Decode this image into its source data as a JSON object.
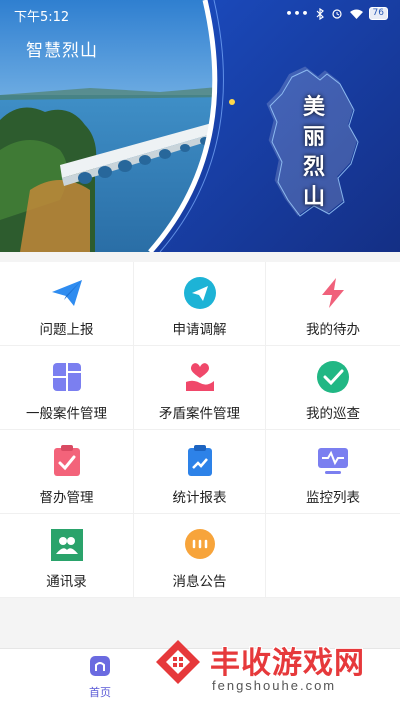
{
  "status_bar": {
    "time": "下午5:12",
    "battery": "76"
  },
  "header": {
    "title": "智慧烈山",
    "banner_slogan": "美丽烈山"
  },
  "menu": [
    {
      "label": "问题上报",
      "icon": "paper-plane-icon"
    },
    {
      "label": "申请调解",
      "icon": "send-circle-icon"
    },
    {
      "label": "我的待办",
      "icon": "lightning-icon"
    },
    {
      "label": "一般案件管理",
      "icon": "grid-panel-icon"
    },
    {
      "label": "矛盾案件管理",
      "icon": "heart-hand-icon"
    },
    {
      "label": "我的巡查",
      "icon": "check-circle-icon"
    },
    {
      "label": "督办管理",
      "icon": "clipboard-check-icon"
    },
    {
      "label": "统计报表",
      "icon": "clipboard-chart-icon"
    },
    {
      "label": "监控列表",
      "icon": "monitor-icon"
    },
    {
      "label": "通讯录",
      "icon": "contacts-icon"
    },
    {
      "label": "消息公告",
      "icon": "chat-bubble-icon"
    }
  ],
  "bottom_nav": {
    "home_label": "首页"
  },
  "watermark": {
    "chinese": "丰收游戏网",
    "english": "fengshouhe.com"
  },
  "colors": {
    "blue_banner": "#1c3fa8",
    "accent": "#5b5bd6",
    "watermark_red": "#e6393b"
  }
}
